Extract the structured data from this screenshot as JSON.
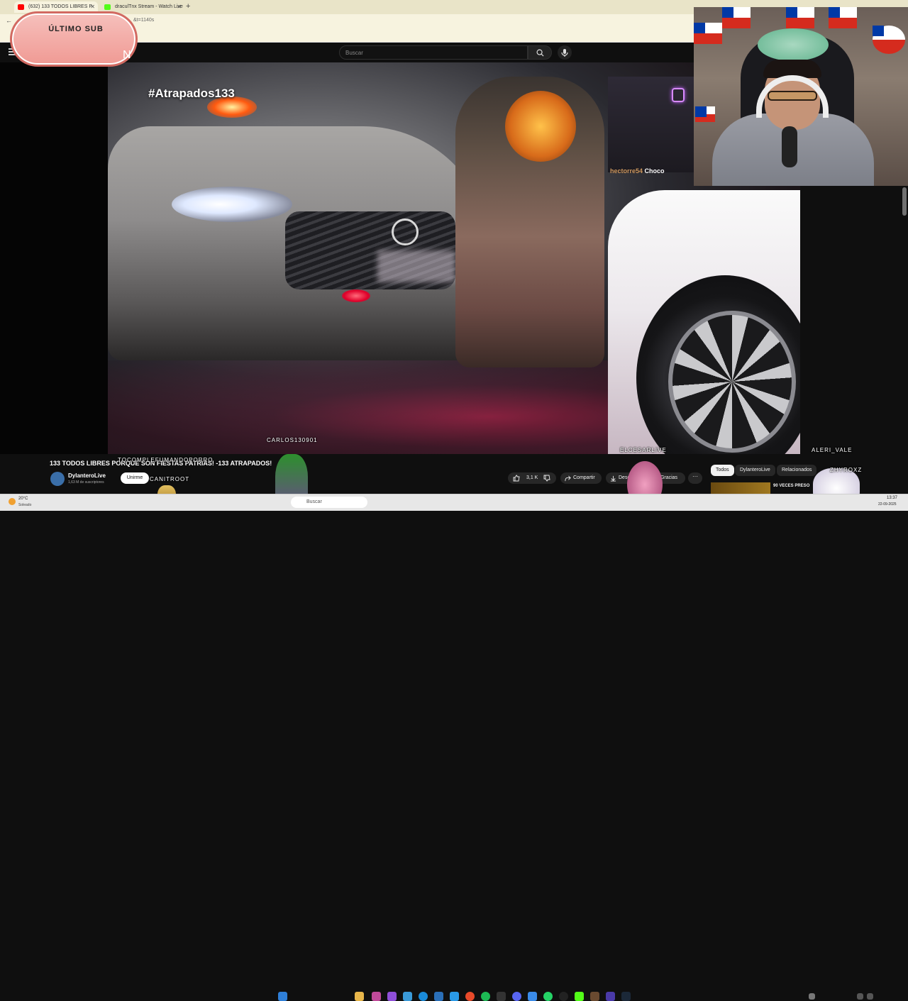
{
  "browser": {
    "tabs": [
      {
        "label": "(632) 133 TODOS LIBRES P",
        "active": true
      },
      {
        "label": "draculTnx Stream - Watch Live",
        "active": false
      }
    ],
    "address_fragment": "&t=1140s"
  },
  "youtube": {
    "search_placeholder": "Buscar",
    "video_title": "133 TODOS LIBRES PORQUE SON FIESTAS PATRIAS! -133 ATRAPADOS!",
    "channel_name": "DylanteroLive",
    "subscribers": "1,63 M de suscriptores",
    "join_label": "Unirme",
    "like_count": "3,1 K",
    "share_label": "Compartir",
    "download_label": "Descargar",
    "thanks_label": "Gracias",
    "more_label": "···",
    "chips": [
      "Todos",
      "DylanteroLive",
      "Relacionados"
    ],
    "rec_title": "90 VECES PRESO"
  },
  "video": {
    "watermark": "#Atrapados133",
    "chat_user": "hectorre54",
    "chat_msg": "Choco"
  },
  "overlay": {
    "ultimo_sub_title": "ÚLTIMO SUB",
    "ultimo_sub_name": "N",
    "chat_names": [
      "TOCOMPLEFUMANDOPORRO",
      "CANITROOT",
      "CARLOS130901",
      "ELCESARLIVE",
      "ALERI_VALE",
      "ZHYROXZ"
    ]
  },
  "taskbar": {
    "weather_temp": "20°C",
    "weather_desc": "Soleado",
    "search_placeholder": "Buscar",
    "time": "13:37",
    "date": "22-09-2025"
  },
  "colors": {
    "yt_bg": "#0f0f0f",
    "chile_red": "#d52b1e",
    "chile_blue": "#0039a6",
    "overlay_pink": "#f09a94"
  }
}
